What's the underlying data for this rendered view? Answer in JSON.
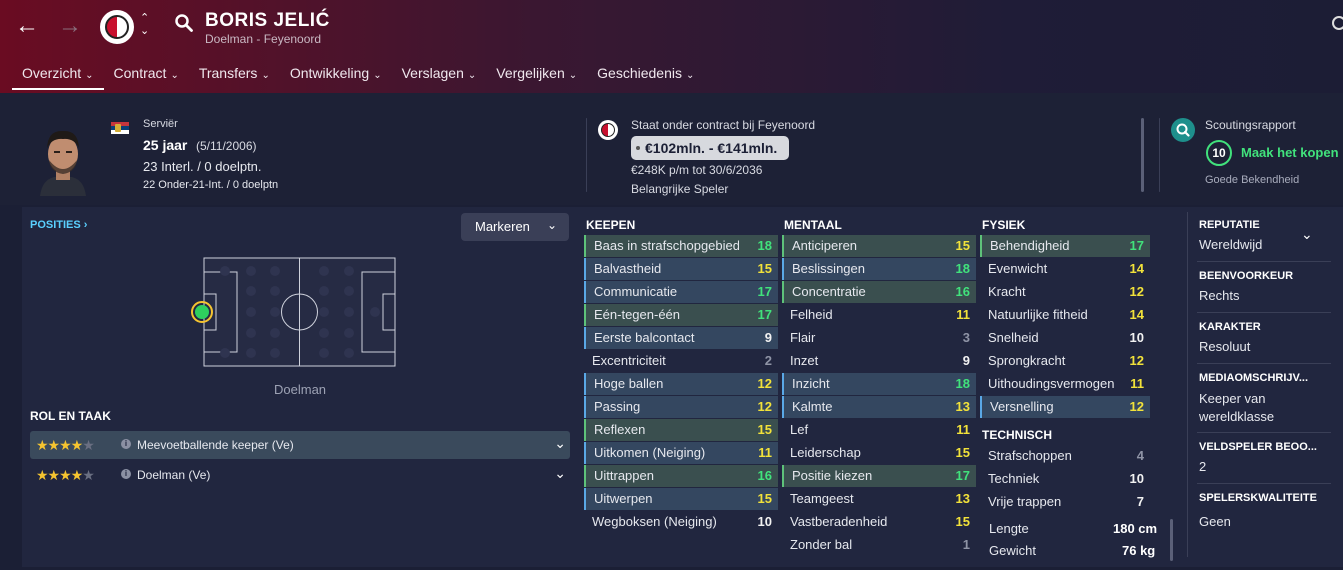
{
  "header": {
    "player_name": "BORIS JELIĆ",
    "player_sub": "Doelman - Feyenoord"
  },
  "tabs": [
    {
      "label": "Overzicht"
    },
    {
      "label": "Contract"
    },
    {
      "label": "Transfers"
    },
    {
      "label": "Ontwikkeling"
    },
    {
      "label": "Verslagen"
    },
    {
      "label": "Vergelijken"
    },
    {
      "label": "Geschiedenis"
    }
  ],
  "profile": {
    "nationality": "Serviër",
    "age": "25 jaar",
    "dob": "(5/11/2006)",
    "caps": "23 Interl. / 0 doelptn.",
    "u21_caps": "22 Onder-21-Int. / 0 doelptn"
  },
  "contract": {
    "status": "Staat onder contract bij Feyenoord",
    "value": "€102mln. - €141mln.",
    "wage": "€248K p/m tot 30/6/2036",
    "squad_status": "Belangrijke Speler"
  },
  "scouting": {
    "title": "Scoutingsrapport",
    "rating": "10",
    "recommendation": "Maak het kopen",
    "knowledge": "Goede Bekendheid"
  },
  "positions": {
    "label": "POSITIES ›",
    "markers_button": "Markeren",
    "caption": "Doelman"
  },
  "roles": {
    "title": "ROL EN TAAK",
    "items": [
      {
        "name": "Meevoetballende keeper (Ve)",
        "stars": 4
      },
      {
        "name": "Doelman (Ve)",
        "stars": 4
      }
    ]
  },
  "keepen": {
    "title": "KEEPEN",
    "items": [
      {
        "name": "Baas in strafschopgebied",
        "value": "18",
        "color": "#41e27c",
        "hl": "green"
      },
      {
        "name": "Balvastheid",
        "value": "15",
        "color": "#f2e23a",
        "hl": "blue"
      },
      {
        "name": "Communicatie",
        "value": "17",
        "color": "#41e27c",
        "hl": "blue"
      },
      {
        "name": "Eén-tegen-één",
        "value": "17",
        "color": "#41e27c",
        "hl": "green"
      },
      {
        "name": "Eerste balcontact",
        "value": "9",
        "color": "#f2f2f2",
        "hl": "blue"
      },
      {
        "name": "Excentriciteit",
        "value": "2",
        "color": "#8f94a6",
        "hl": ""
      },
      {
        "name": "Hoge ballen",
        "value": "12",
        "color": "#f2e23a",
        "hl": "blue"
      },
      {
        "name": "Passing",
        "value": "12",
        "color": "#f2e23a",
        "hl": "blue"
      },
      {
        "name": "Reflexen",
        "value": "15",
        "color": "#f2e23a",
        "hl": "green"
      },
      {
        "name": "Uitkomen (Neiging)",
        "value": "11",
        "color": "#f2e23a",
        "hl": "blue"
      },
      {
        "name": "Uittrappen",
        "value": "16",
        "color": "#41e27c",
        "hl": "green"
      },
      {
        "name": "Uitwerpen",
        "value": "15",
        "color": "#f2e23a",
        "hl": "blue"
      },
      {
        "name": "Wegboksen (Neiging)",
        "value": "10",
        "color": "#f2f2f2",
        "hl": ""
      }
    ]
  },
  "mentaal": {
    "title": "MENTAAL",
    "items": [
      {
        "name": "Anticiperen",
        "value": "15",
        "color": "#f2e23a",
        "hl": "green"
      },
      {
        "name": "Beslissingen",
        "value": "18",
        "color": "#41e27c",
        "hl": "blue"
      },
      {
        "name": "Concentratie",
        "value": "16",
        "color": "#41e27c",
        "hl": "green"
      },
      {
        "name": "Felheid",
        "value": "11",
        "color": "#f2e23a",
        "hl": ""
      },
      {
        "name": "Flair",
        "value": "3",
        "color": "#8f94a6",
        "hl": ""
      },
      {
        "name": "Inzet",
        "value": "9",
        "color": "#f2f2f2",
        "hl": ""
      },
      {
        "name": "Inzicht",
        "value": "18",
        "color": "#41e27c",
        "hl": "blue"
      },
      {
        "name": "Kalmte",
        "value": "13",
        "color": "#f2e23a",
        "hl": "blue"
      },
      {
        "name": "Lef",
        "value": "11",
        "color": "#f2e23a",
        "hl": ""
      },
      {
        "name": "Leiderschap",
        "value": "15",
        "color": "#f2e23a",
        "hl": ""
      },
      {
        "name": "Positie kiezen",
        "value": "17",
        "color": "#41e27c",
        "hl": "green"
      },
      {
        "name": "Teamgeest",
        "value": "13",
        "color": "#f2e23a",
        "hl": ""
      },
      {
        "name": "Vastberadenheid",
        "value": "15",
        "color": "#f2e23a",
        "hl": ""
      },
      {
        "name": "Zonder bal",
        "value": "1",
        "color": "#8f94a6",
        "hl": ""
      }
    ]
  },
  "fysiek": {
    "title": "FYSIEK",
    "items": [
      {
        "name": "Behendigheid",
        "value": "17",
        "color": "#41e27c",
        "hl": "green"
      },
      {
        "name": "Evenwicht",
        "value": "14",
        "color": "#f2e23a",
        "hl": ""
      },
      {
        "name": "Kracht",
        "value": "12",
        "color": "#f2e23a",
        "hl": ""
      },
      {
        "name": "Natuurlijke fitheid",
        "value": "14",
        "color": "#f2e23a",
        "hl": ""
      },
      {
        "name": "Snelheid",
        "value": "10",
        "color": "#f2f2f2",
        "hl": ""
      },
      {
        "name": "Sprongkracht",
        "value": "12",
        "color": "#f2e23a",
        "hl": ""
      },
      {
        "name": "Uithoudingsvermogen",
        "value": "11",
        "color": "#f2e23a",
        "hl": ""
      },
      {
        "name": "Versnelling",
        "value": "12",
        "color": "#f2e23a",
        "hl": "blue"
      }
    ]
  },
  "technisch": {
    "title": "TECHNISCH",
    "items": [
      {
        "name": "Strafschoppen",
        "value": "4",
        "color": "#8f94a6",
        "hl": ""
      },
      {
        "name": "Techniek",
        "value": "10",
        "color": "#f2f2f2",
        "hl": ""
      },
      {
        "name": "Vrije trappen",
        "value": "7",
        "color": "#f2f2f2",
        "hl": ""
      }
    ]
  },
  "physique": {
    "height_label": "Lengte",
    "height_value": "180 cm",
    "weight_label": "Gewicht",
    "weight_value": "76 kg"
  },
  "sidebar": [
    {
      "head": "REPUTATIE",
      "value": "Wereldwijd"
    },
    {
      "head": "BEENVOORKEUR",
      "value": "Rechts"
    },
    {
      "head": "KARAKTER",
      "value": "Resoluut"
    },
    {
      "head": "MEDIAOMSCHRIJV...",
      "value": "Keeper van wereldklasse"
    },
    {
      "head": "VELDSPELER BEOO...",
      "value": "2"
    },
    {
      "head": "SPELERSKWALITEITE",
      "value": "Geen"
    }
  ]
}
